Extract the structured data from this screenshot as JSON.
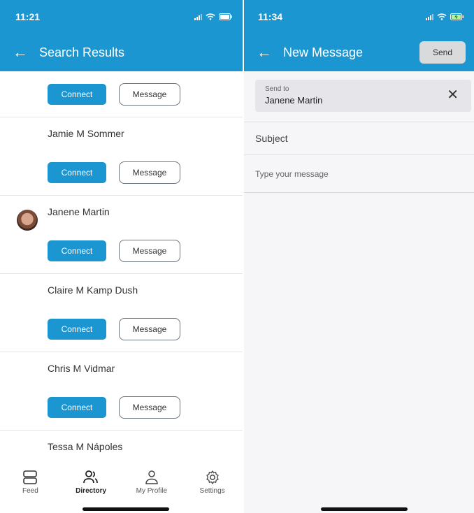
{
  "left": {
    "status": {
      "time": "11:21"
    },
    "header": {
      "title": "Search Results"
    },
    "connect_label": "Connect",
    "message_label": "Message",
    "people": [
      {
        "name": "Jamie M Sommer"
      },
      {
        "name": "Janene Martin"
      },
      {
        "name": "Claire M Kamp Dush"
      },
      {
        "name": "Chris M Vidmar"
      },
      {
        "name": "Tessa M Nápoles"
      }
    ],
    "tabs": [
      {
        "label": "Feed",
        "icon": "feed-icon"
      },
      {
        "label": "Directory",
        "icon": "people-icon",
        "active": true
      },
      {
        "label": "My Profile",
        "icon": "person-icon"
      },
      {
        "label": "Settings",
        "icon": "gear-icon"
      }
    ]
  },
  "right": {
    "status": {
      "time": "11:34"
    },
    "header": {
      "title": "New Message",
      "send_label": "Send"
    },
    "send_to": {
      "label": "Send to",
      "value": "Janene Martin"
    },
    "subject_placeholder": "Subject",
    "message_placeholder": "Type your message"
  },
  "colors": {
    "accent": "#1c96d1",
    "send_disabled": "#d8dadc"
  }
}
